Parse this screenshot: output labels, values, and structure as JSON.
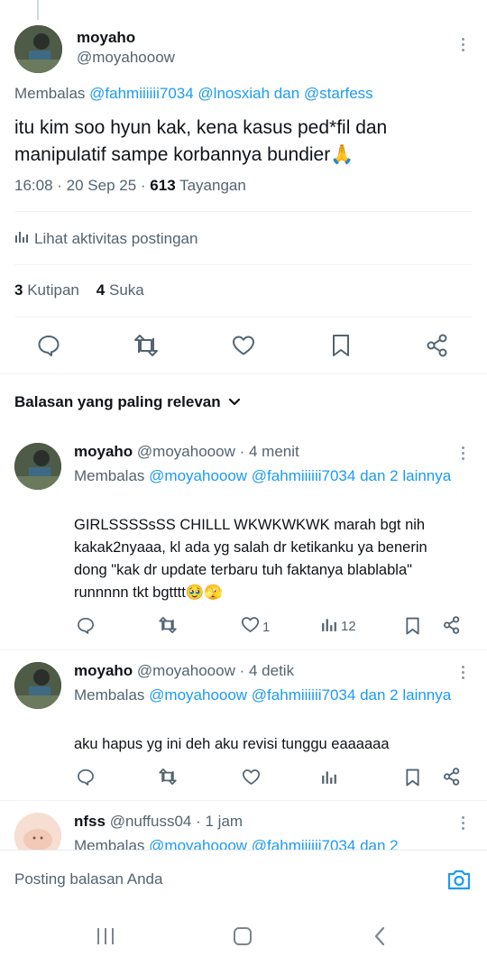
{
  "main_tweet": {
    "display_name": "moyaho",
    "handle": "@moyahooow",
    "reply_prefix": "Membalas",
    "reply_mentions": "@fahmiiiiii7034 @lnosxiah",
    "reply_conj": "dan",
    "reply_last": "@starfess",
    "text": "itu kim soo hyun kak, kena kasus ped*fil dan manipulatif sampe korbannya bundier",
    "emoji": "🙏",
    "time": "16:08 · 20 Sep 25 ·",
    "views_count": "613",
    "views_label": "Tayangan",
    "activity_label": "Lihat aktivitas postingan",
    "quotes_count": "3",
    "quotes_label": "Kutipan",
    "likes_count": "4",
    "likes_label": "Suka"
  },
  "sort": {
    "label": "Balasan yang paling relevan"
  },
  "replies": [
    {
      "display_name": "moyaho",
      "handle": "@moyahooow",
      "time": "· 4 menit",
      "reply_prefix": "Membalas",
      "reply_mentions": "@moyahooow @fahmiiiiii7034",
      "reply_suffix": "dan 2 lainnya",
      "text": "GIRLSSSSsSS CHILLL WKWKWKWK marah bgt nih kakak2nyaaa, kl ada yg salah dr ketikanku ya benerin dong \"kak dr update terbaru tuh faktanya blablabla\" runnnnn tkt bgtttt🥹🫣",
      "likes": "1",
      "views": "12"
    },
    {
      "display_name": "moyaho",
      "handle": "@moyahooow",
      "time": "· 4 detik",
      "reply_prefix": "Membalas",
      "reply_mentions": "@moyahooow @fahmiiiiii7034",
      "reply_suffix": "dan 2 lainnya",
      "text": "aku hapus yg ini deh aku revisi tunggu eaaaaaa"
    },
    {
      "display_name": "nfss",
      "handle": "@nuffuss04",
      "time": "· 1 jam",
      "reply_prefix": "Membalas",
      "reply_mentions": "@moyahooow @fahmiiiiii7034",
      "reply_suffix": "dan 2"
    }
  ],
  "composer": {
    "placeholder": "Posting balasan Anda"
  },
  "icons": {
    "reply": "reply-icon",
    "retweet": "retweet-icon",
    "like": "heart-icon",
    "bookmark": "bookmark-icon",
    "share": "share-icon",
    "views": "views-icon",
    "camera": "camera-icon",
    "chevron": "chevron-down-icon",
    "more": "more-icon"
  },
  "colors": {
    "accent": "#1d9bf0",
    "text": "#0f1419",
    "muted": "#536471"
  }
}
